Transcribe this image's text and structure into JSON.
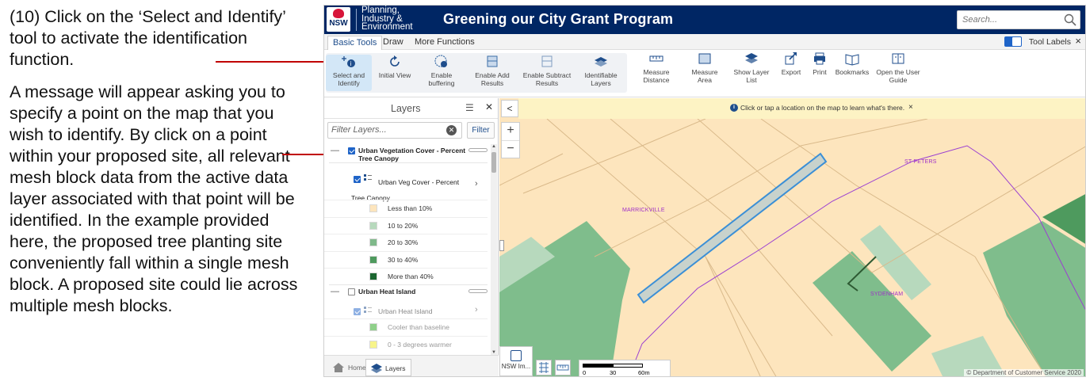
{
  "instructions": {
    "step": "(10) Click on the ‘Select and Identify’ tool to activate the identification function.",
    "detail": "A message will appear asking you to specify a point on the map that you wish to identify. By click on a point within your proposed site, all relevant mesh block data from the active data layer associated with that point will be identified. In the example provided here, the proposed tree planting site conveniently fall within a single mesh block. A proposed site could lie across multiple mesh blocks."
  },
  "header": {
    "logo_text": "NSW",
    "dept_line1": "Planning,",
    "dept_line2": "Industry &",
    "dept_line3": "Environment",
    "title": "Greening our City Grant Program",
    "search_placeholder": "Search..."
  },
  "tabs": {
    "basic": "Basic Tools",
    "draw": "Draw",
    "more": "More Functions",
    "tool_labels": "Tool Labels",
    "close": "×"
  },
  "ribbon": {
    "select_identify": "Select and Identify",
    "initial_view": "Initial View",
    "enable_buffering": "Enable buffering",
    "enable_add": "Enable Add Results",
    "enable_subtract": "Enable Subtract Results",
    "identifiable_layers": "Identifiable Layers",
    "measure_distance": "Measure Distance",
    "measure_area": "Measure Area",
    "show_layer_list": "Show Layer List",
    "export": "Export",
    "print": "Print",
    "bookmarks": "Bookmarks",
    "user_guide": "Open the User Guide"
  },
  "layers_panel": {
    "title": "Layers",
    "filter_placeholder": "Filter Layers...",
    "filter_button": "Filter",
    "layer1_name": "Urban Vegetation Cover - Percent Tree Canopy",
    "layer1_sub": "Urban Veg Cover - Percent Tree Canopy",
    "legend1": [
      {
        "label": "Less than 10%",
        "color": "#fde5bd"
      },
      {
        "label": "10 to 20%",
        "color": "#b7d9bd"
      },
      {
        "label": "20 to 30%",
        "color": "#7fb98a"
      },
      {
        "label": "30 to 40%",
        "color": "#4e9a5e"
      },
      {
        "label": "More than 40%",
        "color": "#1c6630"
      }
    ],
    "layer2_name": "Urban Heat Island",
    "layer2_sub": "Urban Heat Island",
    "legend2": [
      {
        "label": "Cooler than baseline",
        "color": "#8fd08a"
      },
      {
        "label": "0 - 3 degrees warmer",
        "color": "#f7f48a"
      }
    ],
    "footer_home": "Home",
    "footer_layers": "Layers"
  },
  "map": {
    "info_message": "Click or tap a location on the map to learn what's there.",
    "info_close": "×",
    "zoom_in": "+",
    "zoom_out": "−",
    "collapse": "<",
    "label_marrickville": "MARRICKVILLE",
    "label_st_peters": "ST PETERS",
    "label_sydenham": "SYDENHAM",
    "basemap_label": "NSW Im...",
    "scale_0": "0",
    "scale_30": "30",
    "scale_60": "60m",
    "copyright": "© Department of Customer Service 2020"
  },
  "colors": {
    "header_navy": "#002664",
    "accent_blue": "#1f64c8",
    "arrow_red": "#c00000",
    "map_base": "#fde5bd"
  }
}
